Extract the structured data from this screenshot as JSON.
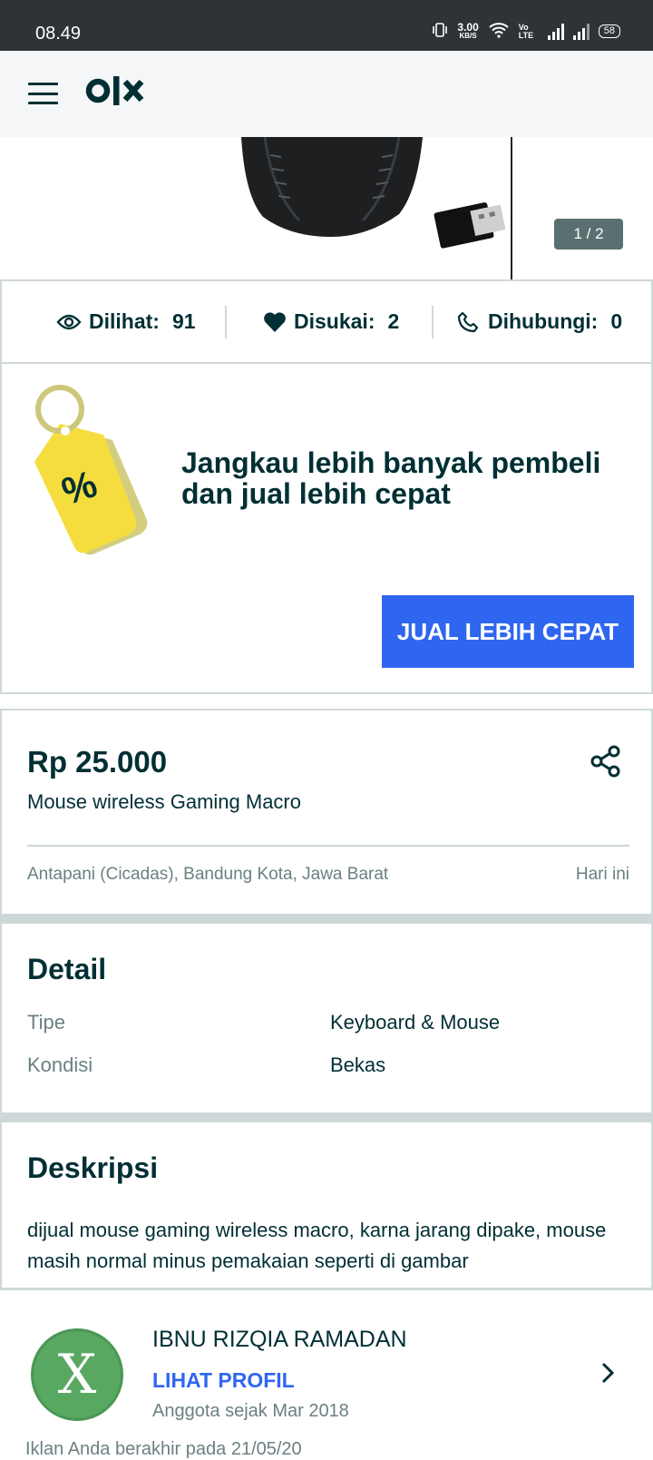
{
  "status_bar": {
    "time": "08.49",
    "net_speed": "3.00",
    "net_unit": "KB/S",
    "volte": "Vo LTE",
    "battery": "58"
  },
  "app_bar": {
    "logo": "olx",
    "menu_icon": "hamburger-icon"
  },
  "gallery": {
    "counter": "1 / 2"
  },
  "stats": {
    "views_label": "Dilihat:",
    "views_value": "91",
    "likes_label": "Disukai:",
    "likes_value": "2",
    "contacts_label": "Dihubungi:",
    "contacts_value": "0"
  },
  "promo": {
    "title": "Jangkau lebih banyak pembeli dan jual lebih cepat",
    "button_label": "JUAL LEBIH CEPAT",
    "tag_symbol": "%"
  },
  "listing": {
    "price": "Rp 25.000",
    "title": "Mouse wireless Gaming Macro",
    "location": "Antapani (Cicadas), Bandung Kota, Jawa Barat",
    "date": "Hari ini"
  },
  "detail": {
    "heading": "Detail",
    "rows": [
      {
        "key": "Tipe",
        "value": "Keyboard & Mouse"
      },
      {
        "key": "Kondisi",
        "value": "Bekas"
      }
    ]
  },
  "description": {
    "heading": "Deskripsi",
    "text": "dijual mouse gaming wireless macro, karna jarang dipake, mouse masih normal minus pemakaian seperti di gambar"
  },
  "seller": {
    "avatar_letter": "X",
    "name": "IBNU RIZQIA RAMADAN",
    "profile_link": "LIHAT PROFIL",
    "member_since": "Anggota sejak Mar 2018",
    "ad_expiry": "Iklan Anda berakhir pada 21/05/20"
  },
  "colors": {
    "primary_text": "#002f34",
    "accent_blue": "#2f66f0",
    "muted_text": "#6b8082",
    "status_bar": "#2f3337",
    "tag_yellow": "#f5dd3e"
  }
}
